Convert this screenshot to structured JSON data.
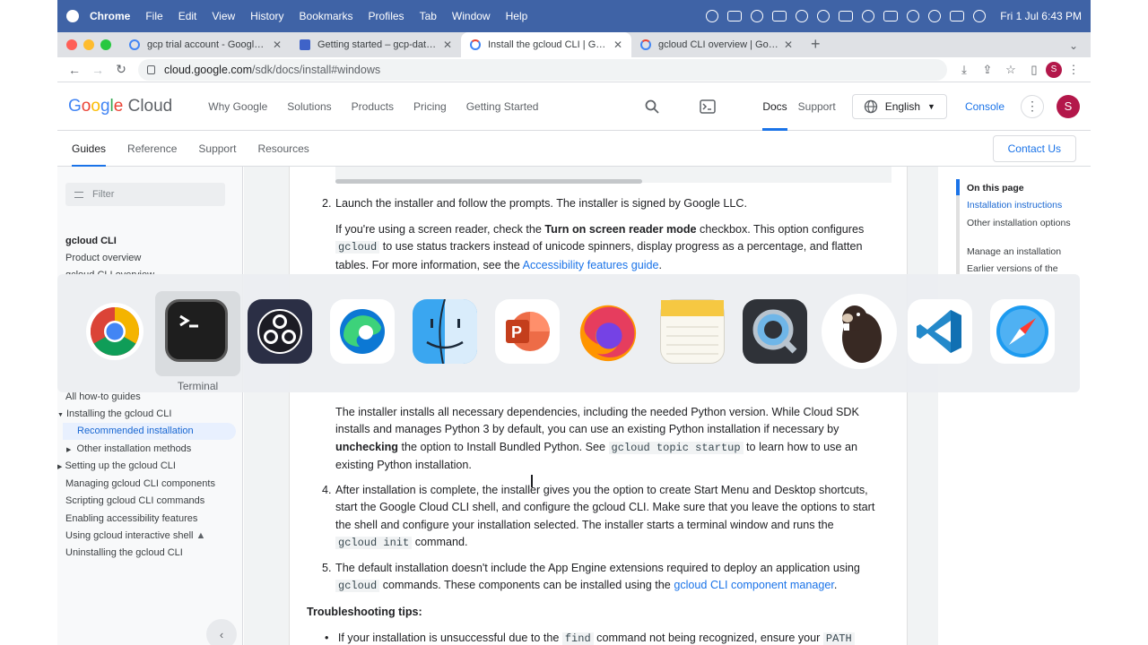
{
  "menubar": {
    "app": "Chrome",
    "items": [
      "File",
      "Edit",
      "View",
      "History",
      "Bookmarks",
      "Profiles",
      "Tab",
      "Window",
      "Help"
    ],
    "clock": "Fri 1 Jul  6:43 PM"
  },
  "tabs": [
    {
      "title": "gcp trial account - Google Sea",
      "fav": "#4285f4",
      "active": false
    },
    {
      "title": "Getting started – gcp-data-pro",
      "fav": "#3f63c8",
      "active": false
    },
    {
      "title": "Install the gcloud CLI  |  Googl",
      "fav": "#4285f4",
      "active": true
    },
    {
      "title": "gcloud CLI overview  |  Google",
      "fav": "#4285f4",
      "active": false
    }
  ],
  "address": {
    "host": "cloud.google.com",
    "path": "/sdk/docs/install#windows",
    "avatar": "S"
  },
  "gcheader": {
    "logo_google": "Google",
    "logo_cloud": "Cloud",
    "nav": [
      "Why Google",
      "Solutions",
      "Products",
      "Pricing",
      "Getting Started"
    ],
    "docs": "Docs",
    "support": "Support",
    "language": "English",
    "console": "Console",
    "avatar": "S"
  },
  "subnav": {
    "items": [
      "Guides",
      "Reference",
      "Support",
      "Resources"
    ],
    "contact": "Contact Us"
  },
  "sidebar": {
    "filter_placeholder": "Filter",
    "section": "gcloud CLI",
    "product_overview": "Product overview",
    "partial": "gcloud CLI overview",
    "items": [
      "All how-to guides",
      "Installing the gcloud CLI",
      "Recommended installation",
      "Other installation methods",
      "Setting up the gcloud CLI",
      "Managing gcloud CLI components",
      "Scripting gcloud CLI commands",
      "Enabling accessibility features",
      "Using gcloud interactive shell",
      "Uninstalling the gcloud CLI"
    ]
  },
  "content": {
    "step2_num": "2.",
    "step2": "Launch the installer and follow the prompts. The installer is signed by Google LLC.",
    "sr_a": "If you're using a screen reader, check the ",
    "sr_b": "Turn on screen reader mode",
    "sr_c": " checkbox. This option configures",
    "sr_code": "gcloud",
    "sr_d": " to use status trackers instead of unicode spinners, display progress as a percentage, and flatten",
    "sr_e": "tables. For more information, see the ",
    "sr_link": "Accessibility features guide",
    "sr_f": ".",
    "py_1": "The installer installs all necessary dependencies, including the needed Python version. While Cloud SDK",
    "py_2": "installs and manages Python 3 by default, you can use an existing Python installation if necessary by",
    "py_b": "unchecking",
    "py_3": " the option to Install Bundled Python. See ",
    "py_code": "gcloud topic startup",
    "py_4": " to learn how to use an",
    "py_5": "existing Python installation.",
    "step4_num": "4.",
    "s4_1": "After installation is complete, the installer gives you the option to create Start Menu and Desktop shortcuts,",
    "s4_2": "start the Google Cloud CLI shell, and configure the gcloud CLI. Make sure that you leave the options to start",
    "s4_3": "the shell and configure your installation selected. The installer starts a terminal window and runs the",
    "s4_code": "gcloud init",
    "s4_4": " command.",
    "step5_num": "5.",
    "s5_1": "The default installation doesn't include the App Engine extensions required to deploy an application using",
    "s5_code": "gcloud",
    "s5_2": " commands. These components can be installed using the ",
    "s5_link": "gcloud CLI component manager",
    "s5_3": ".",
    "trouble": "Troubleshooting tips:",
    "t1_a": "If your installation is unsuccessful due to the ",
    "t1_code": "find",
    "t1_b": " command not being recognized, ensure your ",
    "t1_code2": "PATH"
  },
  "toc": {
    "heading": "On this page",
    "items": [
      "Installation instructions",
      "Other installation options",
      "Manage an installation",
      "Earlier versions of the"
    ]
  },
  "switcher": {
    "apps": [
      "chrome-icon",
      "terminal-icon",
      "obs-icon",
      "edge-icon",
      "finder-icon",
      "powerpoint-icon",
      "firefox-icon",
      "notes-icon",
      "quicktime-icon",
      "dbeaver-icon",
      "vscode-icon",
      "safari-icon"
    ],
    "selected_label": "Terminal"
  }
}
